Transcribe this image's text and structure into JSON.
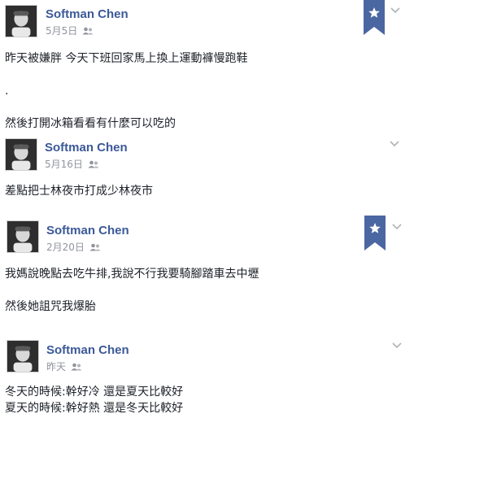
{
  "posts": [
    {
      "author": "Softman Chen",
      "date": "5月5日",
      "audience_icon": "friends-icon",
      "starred": true,
      "text": "昨天被嫌胖 今天下班回家馬上換上運動褲慢跑鞋\n\n.\n\n然後打開冰箱看看有什麼可以吃的"
    },
    {
      "author": "Softman Chen",
      "date": "5月16日",
      "audience_icon": "friends-icon",
      "starred": false,
      "text": "差點把士林夜市打成少林夜市"
    },
    {
      "author": "Softman Chen",
      "date": "2月20日",
      "audience_icon": "friends-icon",
      "starred": true,
      "text": "我媽說晚點去吃牛排,我說不行我要騎腳踏車去中壢\n\n然後她詛咒我爆胎"
    },
    {
      "author": "Softman Chen",
      "date": "昨天",
      "audience_icon": "friends-icon",
      "starred": false,
      "text": "冬天的時候:幹好冷 還是夏天比較好\n夏天的時候:幹好熱 還是冬天比較好"
    }
  ],
  "colors": {
    "author": "#3b5998",
    "meta": "#90949c",
    "bookmark": "#4b67a1"
  }
}
